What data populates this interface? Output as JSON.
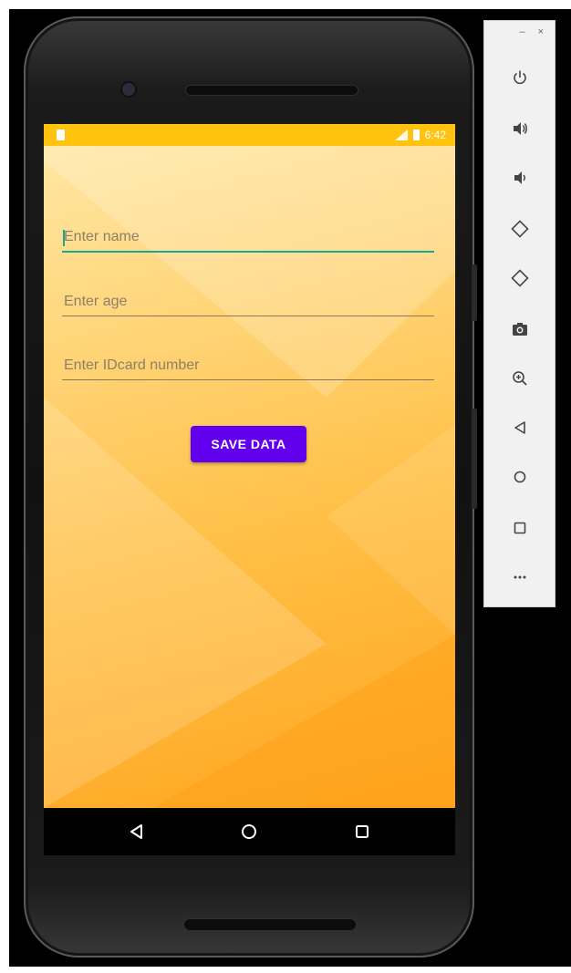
{
  "status_bar": {
    "time": "6:42"
  },
  "form": {
    "name_placeholder": "Enter name",
    "age_placeholder": "Enter age",
    "idcard_placeholder": "Enter IDcard number",
    "save_label": "SAVE DATA"
  },
  "nav": {
    "icons": [
      "back-icon",
      "home-icon",
      "recents-icon"
    ]
  },
  "sidebar": {
    "window_controls": {
      "minimize": "–",
      "close": "×"
    },
    "tools": [
      "power-icon",
      "volume-up-icon",
      "volume-down-icon",
      "rotate-left-icon",
      "rotate-right-icon",
      "camera-icon",
      "zoom-icon",
      "back-icon",
      "home-icon",
      "overview-icon",
      "more-icon"
    ]
  },
  "colors": {
    "status_bar": "#ffc20e",
    "accent_button": "#6200ee",
    "focus_underline": "#16a89a",
    "background_light": "#ffe9a8",
    "background_dark": "#ffa51f"
  }
}
